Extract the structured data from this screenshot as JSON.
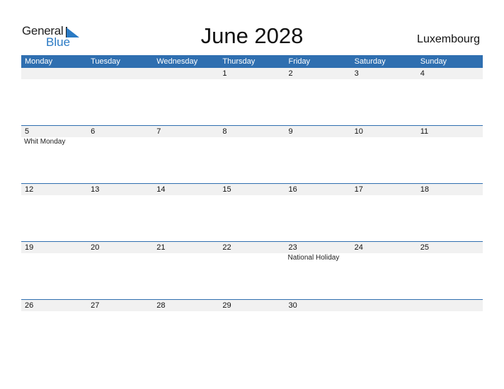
{
  "logo": {
    "general": "General",
    "blue": "Blue"
  },
  "title": "June 2028",
  "country": "Luxembourg",
  "accent_color": "#2f6fb0",
  "weekdays": [
    "Monday",
    "Tuesday",
    "Wednesday",
    "Thursday",
    "Friday",
    "Saturday",
    "Sunday"
  ],
  "weeks": [
    {
      "days": [
        "",
        "",
        "",
        "1",
        "2",
        "3",
        "4"
      ],
      "notes": [
        "",
        "",
        "",
        "",
        "",
        "",
        ""
      ]
    },
    {
      "days": [
        "5",
        "6",
        "7",
        "8",
        "9",
        "10",
        "11"
      ],
      "notes": [
        "Whit Monday",
        "",
        "",
        "",
        "",
        "",
        ""
      ]
    },
    {
      "days": [
        "12",
        "13",
        "14",
        "15",
        "16",
        "17",
        "18"
      ],
      "notes": [
        "",
        "",
        "",
        "",
        "",
        "",
        ""
      ]
    },
    {
      "days": [
        "19",
        "20",
        "21",
        "22",
        "23",
        "24",
        "25"
      ],
      "notes": [
        "",
        "",
        "",
        "",
        "National Holiday",
        "",
        ""
      ]
    },
    {
      "days": [
        "26",
        "27",
        "28",
        "29",
        "30",
        "",
        ""
      ],
      "notes": [
        "",
        "",
        "",
        "",
        "",
        "",
        ""
      ]
    }
  ]
}
